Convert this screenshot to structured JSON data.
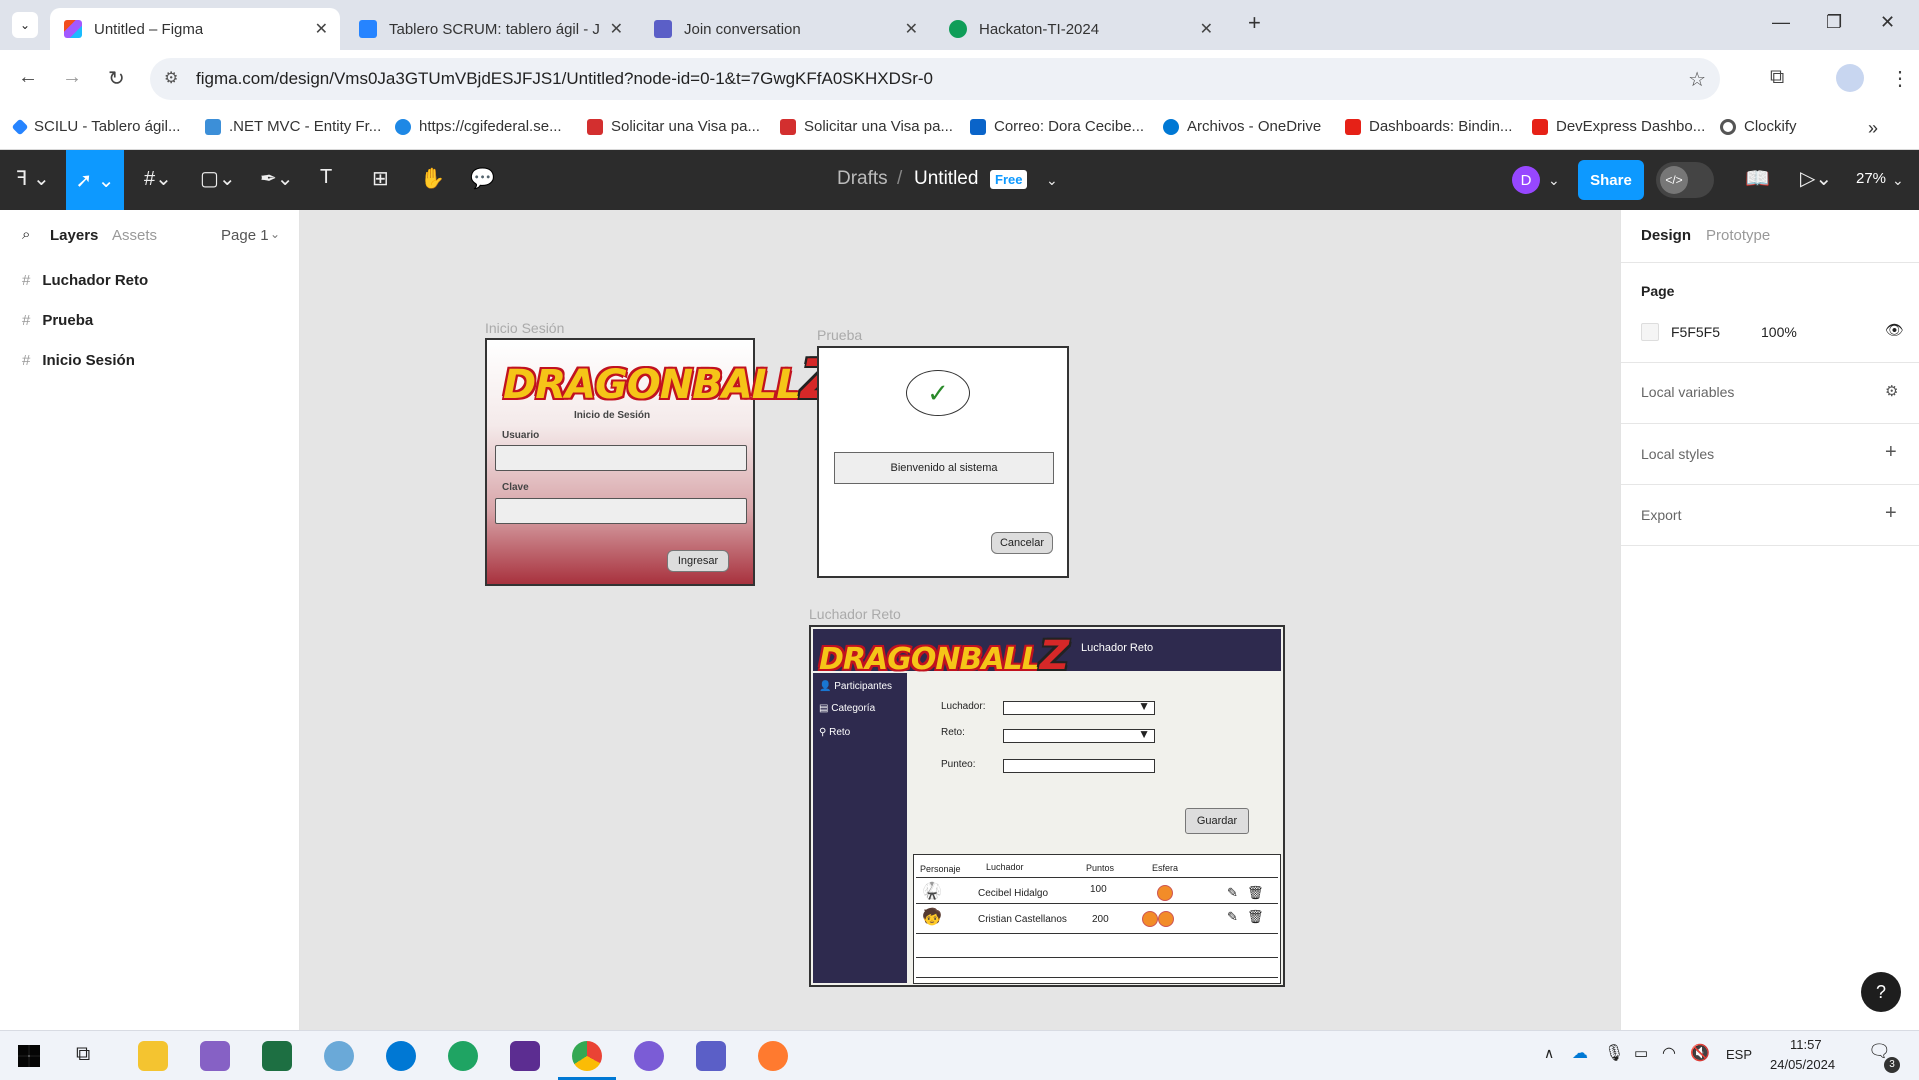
{
  "browser": {
    "tabs": [
      {
        "title": "Untitled – Figma",
        "active": true,
        "icon": "figma-icon"
      },
      {
        "title": "Tablero SCRUM: tablero ágil - Ji",
        "active": false,
        "icon": "jira-icon"
      },
      {
        "title": "Join conversation",
        "active": false,
        "icon": "teams-icon"
      },
      {
        "title": "Hackaton-TI-2024",
        "active": false,
        "icon": "sheets-icon"
      }
    ],
    "url": "figma.com/design/Vms0Ja3GTUmVBjdESJFJS1/Untitled?node-id=0-1&t=7GwgKFfA0SKHXDSr-0",
    "bookmarks": [
      "SCILU - Tablero ágil...",
      ".NET MVC - Entity Fr...",
      "https://cgifederal.se...",
      "Solicitar una Visa pa...",
      "Solicitar una Visa pa...",
      "Correo: Dora Cecibe...",
      "Archivos - OneDrive",
      "Dashboards: Bindin...",
      "DevExpress Dashbo...",
      "Clockify"
    ]
  },
  "figma": {
    "breadcrumb_drafts": "Drafts",
    "breadcrumb_sep": "/",
    "file_name": "Untitled",
    "plan_badge": "Free",
    "avatar_letter": "D",
    "share_label": "Share",
    "zoom": "27%",
    "left_panel": {
      "tab_layers": "Layers",
      "tab_assets": "Assets",
      "page_selector": "Page 1",
      "layers": [
        "Luchador Reto",
        "Prueba",
        "Inicio Sesión"
      ]
    },
    "right_panel": {
      "tab_design": "Design",
      "tab_prototype": "Prototype",
      "page_heading": "Page",
      "page_color": "F5F5F5",
      "page_opacity": "100%",
      "local_variables": "Local variables",
      "local_styles": "Local styles",
      "export": "Export"
    },
    "help": "?"
  },
  "frames": {
    "login": {
      "label": "Inicio Sesión",
      "logo": "DRAGONBALL",
      "logo_z": "Z",
      "subtitle": "Inicio de Sesión",
      "user_label": "Usuario",
      "password_label": "Clave",
      "submit": "Ingresar"
    },
    "prueba": {
      "label": "Prueba",
      "check": "✓",
      "message": "Bienvenido al sistema",
      "cancel": "Cancelar"
    },
    "reto": {
      "label": "Luchador Reto",
      "logo": "DRAGONBALL",
      "logo_z": "Z",
      "header_title": "Luchador Reto",
      "menu": [
        "Participantes",
        "Categoría",
        "Reto"
      ],
      "field_luchador": "Luchador:",
      "field_reto": "Reto:",
      "field_punteo": "Punteo:",
      "save": "Guardar",
      "table_headers": [
        "Personaje",
        "Luchador",
        "Puntos",
        "Esfera"
      ],
      "rows": [
        {
          "name": "Cecibel Hidalgo",
          "points": "100",
          "spheres": 1
        },
        {
          "name": "Cristian Castellanos",
          "points": "200",
          "spheres": 2
        }
      ]
    }
  },
  "taskbar": {
    "lang": "ESP",
    "time": "11:57",
    "date": "24/05/2024",
    "notifications": "3"
  },
  "colors": {
    "figma_blue": "#0d99ff",
    "toolbar_dark": "#2c2c2c",
    "reto_navy": "#2e2a4e",
    "login_gradient_bottom": "#a8323e"
  }
}
